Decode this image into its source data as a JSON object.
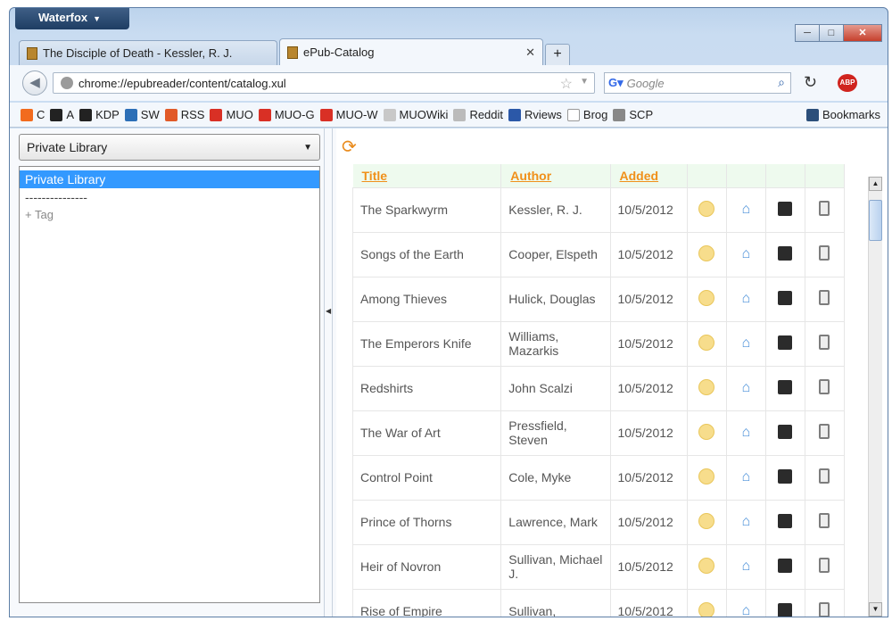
{
  "app": {
    "name": "Waterfox"
  },
  "tabs": [
    {
      "label": "The Disciple of Death - Kessler, R. J."
    },
    {
      "label": "ePub-Catalog"
    }
  ],
  "nav": {
    "url": "chrome://epubreader/content/catalog.xul",
    "search_placeholder": "Google"
  },
  "bookmarks": [
    {
      "label": "C",
      "icon": "c-icon",
      "color": "#f26b1d"
    },
    {
      "label": "A",
      "icon": "amazon-icon",
      "color": "#222222"
    },
    {
      "label": "KDP",
      "icon": "amazon-icon",
      "color": "#222222"
    },
    {
      "label": "SW",
      "icon": "sw-icon",
      "color": "#2c6fb7"
    },
    {
      "label": "RSS",
      "icon": "rss-icon",
      "color": "#e15a28"
    },
    {
      "label": "MUO",
      "icon": "gmail-icon",
      "color": "#d93025"
    },
    {
      "label": "MUO-G",
      "icon": "gmail-icon",
      "color": "#d93025"
    },
    {
      "label": "MUO-W",
      "icon": "gmail-icon",
      "color": "#d93025"
    },
    {
      "label": "MUOWiki",
      "icon": "bulb-icon",
      "color": "#c8c8c8"
    },
    {
      "label": "Reddit",
      "icon": "reddit-icon",
      "color": "#bbbbbb"
    },
    {
      "label": "Rviews",
      "icon": "rviews-icon",
      "color": "#2b58a8"
    },
    {
      "label": "Brog",
      "icon": "blank-page-icon",
      "color": "#ffffff"
    },
    {
      "label": "SCP",
      "icon": "scp-icon",
      "color": "#888888"
    }
  ],
  "bookmarks_menu": "Bookmarks",
  "library": {
    "dropdown_value": "Private Library",
    "list": [
      {
        "label": "Private Library",
        "selected": true
      },
      {
        "label": "---------------",
        "selected": false
      },
      {
        "label": "+ Tag",
        "selected": false
      }
    ]
  },
  "catalog": {
    "columns": [
      "Title",
      "Author",
      "Added"
    ],
    "rows": [
      {
        "title": "The Sparkwyrm",
        "author": "Kessler, R. J.",
        "added": "10/5/2012"
      },
      {
        "title": "Songs of the Earth",
        "author": "Cooper, Elspeth",
        "added": "10/5/2012"
      },
      {
        "title": "Among Thieves",
        "author": "Hulick, Douglas",
        "added": "10/5/2012"
      },
      {
        "title": "The Emperors Knife",
        "author": "Williams, Mazarkis",
        "added": "10/5/2012"
      },
      {
        "title": "Redshirts",
        "author": "John Scalzi",
        "added": "10/5/2012"
      },
      {
        "title": "The War of Art",
        "author": "Pressfield, Steven",
        "added": "10/5/2012"
      },
      {
        "title": "Control Point",
        "author": "Cole, Myke",
        "added": "10/5/2012"
      },
      {
        "title": "Prince of Thorns",
        "author": "Lawrence, Mark",
        "added": "10/5/2012"
      },
      {
        "title": "Heir of Novron",
        "author": "Sullivan, Michael J.",
        "added": "10/5/2012"
      },
      {
        "title": "Rise of Empire",
        "author": "Sullivan,",
        "added": "10/5/2012"
      }
    ]
  }
}
